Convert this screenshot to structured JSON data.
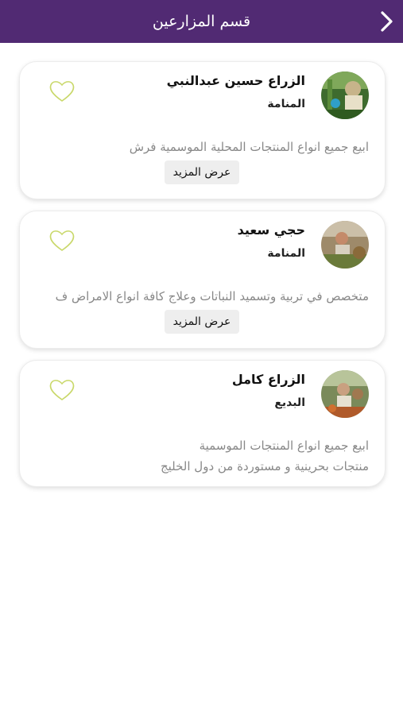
{
  "header": {
    "title": "قسم المزارعين",
    "back_icon": "chevron-right-icon",
    "background": "#512a73"
  },
  "farmers": [
    {
      "name": "الزراع حسين عبدالنبي",
      "location": "المنامة",
      "description": [
        "ابيع جميع انواع المنتجات المحلية الموسمية فرش"
      ],
      "more_label": "عرض المزيد"
    },
    {
      "name": "حجي سعيد",
      "location": "المنامة",
      "description": [
        "متخصص في تربية وتسميد النباتات وعلاج كافة انواع الامراض ف"
      ],
      "more_label": "عرض المزيد"
    },
    {
      "name": "الزراع كامل",
      "location": "البديع",
      "description": [
        "ابيع جميع انواع المنتجات الموسمية",
        "منتجات بحرينية و مستوردة من دول الخليج"
      ]
    }
  ],
  "colors": {
    "heart": "#c9d86a",
    "description": "#888888"
  }
}
